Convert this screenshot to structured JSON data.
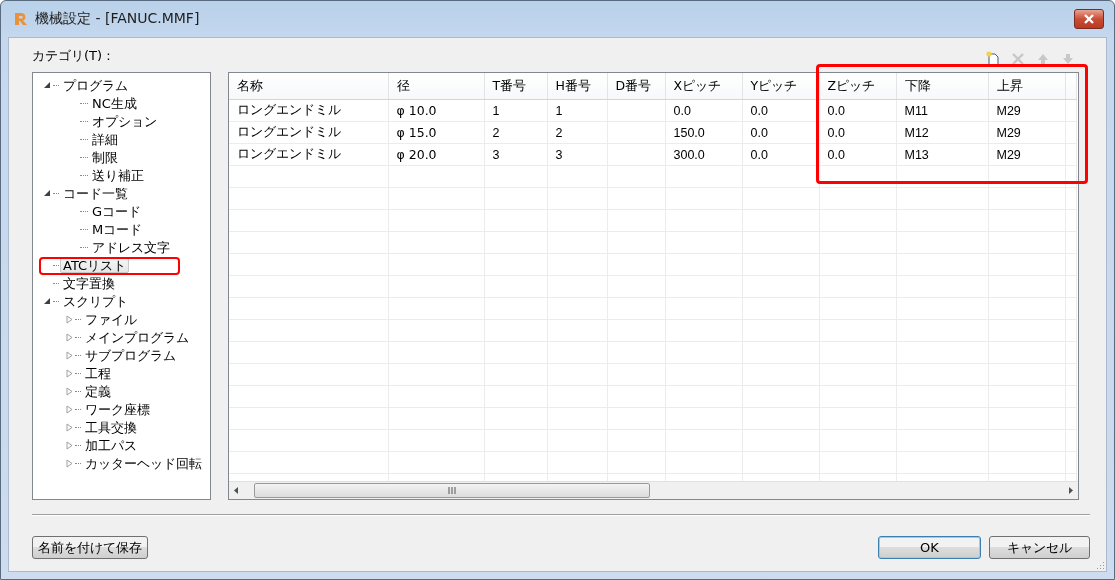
{
  "window": {
    "title": "機械設定 - [FANUC.MMF]"
  },
  "category_label": "カテゴリ(T) :",
  "tree": [
    {
      "label": "プログラム",
      "expanded": true,
      "selected": false,
      "children": [
        {
          "label": "NC生成",
          "selected": false
        },
        {
          "label": "オプション",
          "selected": false
        },
        {
          "label": "詳細",
          "selected": false
        },
        {
          "label": "制限",
          "selected": false
        },
        {
          "label": "送り補正",
          "selected": false
        }
      ]
    },
    {
      "label": "コード一覧",
      "expanded": true,
      "selected": false,
      "children": [
        {
          "label": "Gコード",
          "selected": false
        },
        {
          "label": "Mコード",
          "selected": false
        },
        {
          "label": "アドレス文字",
          "selected": false
        }
      ]
    },
    {
      "label": "ATCリスト",
      "selected": true
    },
    {
      "label": "文字置換",
      "selected": false
    },
    {
      "label": "スクリプト",
      "expanded": true,
      "selected": false,
      "children": [
        {
          "label": "ファイル",
          "expanded": false,
          "selected": false
        },
        {
          "label": "メインプログラム",
          "expanded": false,
          "selected": false
        },
        {
          "label": "サブプログラム",
          "expanded": false,
          "selected": false
        },
        {
          "label": "工程",
          "expanded": false,
          "selected": false
        },
        {
          "label": "定義",
          "expanded": false,
          "selected": false
        },
        {
          "label": "ワーク座標",
          "expanded": false,
          "selected": false
        },
        {
          "label": "工具交換",
          "expanded": false,
          "selected": false
        },
        {
          "label": "加工パス",
          "expanded": false,
          "selected": false
        },
        {
          "label": "カッターヘッド回転",
          "expanded": false,
          "selected": false
        }
      ]
    }
  ],
  "toolbar": [
    {
      "kind": "new",
      "disabled": false
    },
    {
      "kind": "delete",
      "disabled": true
    },
    {
      "kind": "up",
      "disabled": true
    },
    {
      "kind": "down",
      "disabled": true
    }
  ],
  "table": {
    "columns": [
      "名称",
      "径",
      "T番号",
      "H番号",
      "D番号",
      "Xピッチ",
      "Yピッチ",
      "Zピッチ",
      "下降",
      "上昇"
    ],
    "rows": [
      [
        "ロングエンドミル",
        "φ 10.0",
        "1",
        "1",
        null,
        "0.0",
        "0.0",
        "0.0",
        "M11",
        "M29"
      ],
      [
        "ロングエンドミル",
        "φ 15.0",
        "2",
        "2",
        null,
        "150.0",
        "0.0",
        "0.0",
        "M12",
        "M29"
      ],
      [
        "ロングエンドミル",
        "φ 20.0",
        "3",
        "3",
        null,
        "300.0",
        "0.0",
        "0.0",
        "M13",
        "M29"
      ]
    ]
  },
  "buttons": {
    "save_as": "名前を付けて保存",
    "ok": "OK",
    "cancel": "キャンセル"
  }
}
